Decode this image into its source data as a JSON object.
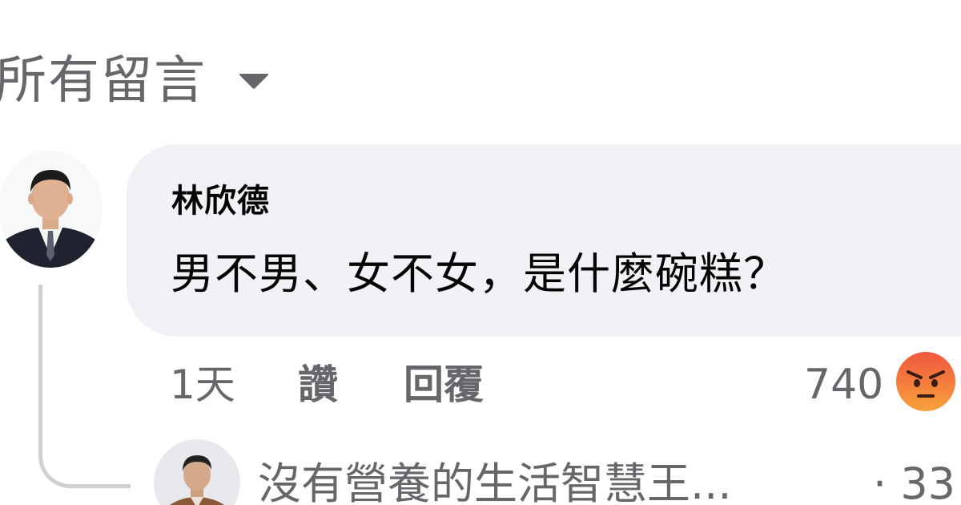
{
  "sort": {
    "label": "所有留言",
    "caret_icon": "caret-down-icon"
  },
  "comment": {
    "author": "林欣德",
    "text": "男不男、女不女，是什麼碗糕？",
    "time": "1天",
    "like_label": "讚",
    "reply_label": "回覆",
    "reaction_count": "740",
    "reaction_icon": "angry-reaction-icon",
    "reaction_color": "#f0573f"
  },
  "reply_preview": {
    "name": "沒有營養的生活智慧王...",
    "time": "· 33"
  },
  "colors": {
    "bubble_bg": "#f0f2f5",
    "secondary_text": "#65676b",
    "primary_text": "#050505",
    "thread_line": "#ced0d4"
  }
}
